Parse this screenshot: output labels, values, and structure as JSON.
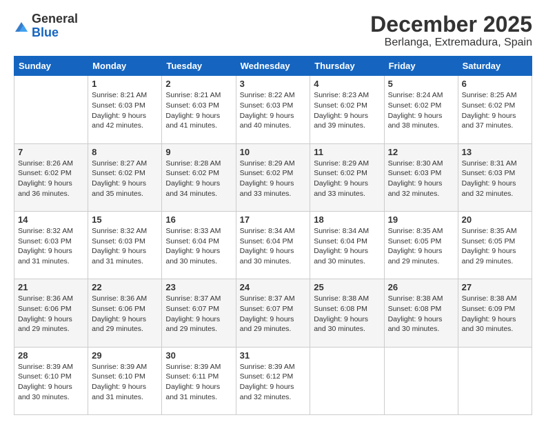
{
  "logo": {
    "general": "General",
    "blue": "Blue"
  },
  "header": {
    "title": "December 2025",
    "subtitle": "Berlanga, Extremadura, Spain"
  },
  "weekdays": [
    "Sunday",
    "Monday",
    "Tuesday",
    "Wednesday",
    "Thursday",
    "Friday",
    "Saturday"
  ],
  "weeks": [
    [
      {
        "day": "",
        "sunrise": "",
        "sunset": "",
        "daylight": ""
      },
      {
        "day": "1",
        "sunrise": "Sunrise: 8:21 AM",
        "sunset": "Sunset: 6:03 PM",
        "daylight": "Daylight: 9 hours and 42 minutes."
      },
      {
        "day": "2",
        "sunrise": "Sunrise: 8:21 AM",
        "sunset": "Sunset: 6:03 PM",
        "daylight": "Daylight: 9 hours and 41 minutes."
      },
      {
        "day": "3",
        "sunrise": "Sunrise: 8:22 AM",
        "sunset": "Sunset: 6:03 PM",
        "daylight": "Daylight: 9 hours and 40 minutes."
      },
      {
        "day": "4",
        "sunrise": "Sunrise: 8:23 AM",
        "sunset": "Sunset: 6:02 PM",
        "daylight": "Daylight: 9 hours and 39 minutes."
      },
      {
        "day": "5",
        "sunrise": "Sunrise: 8:24 AM",
        "sunset": "Sunset: 6:02 PM",
        "daylight": "Daylight: 9 hours and 38 minutes."
      },
      {
        "day": "6",
        "sunrise": "Sunrise: 8:25 AM",
        "sunset": "Sunset: 6:02 PM",
        "daylight": "Daylight: 9 hours and 37 minutes."
      }
    ],
    [
      {
        "day": "7",
        "sunrise": "Sunrise: 8:26 AM",
        "sunset": "Sunset: 6:02 PM",
        "daylight": "Daylight: 9 hours and 36 minutes."
      },
      {
        "day": "8",
        "sunrise": "Sunrise: 8:27 AM",
        "sunset": "Sunset: 6:02 PM",
        "daylight": "Daylight: 9 hours and 35 minutes."
      },
      {
        "day": "9",
        "sunrise": "Sunrise: 8:28 AM",
        "sunset": "Sunset: 6:02 PM",
        "daylight": "Daylight: 9 hours and 34 minutes."
      },
      {
        "day": "10",
        "sunrise": "Sunrise: 8:29 AM",
        "sunset": "Sunset: 6:02 PM",
        "daylight": "Daylight: 9 hours and 33 minutes."
      },
      {
        "day": "11",
        "sunrise": "Sunrise: 8:29 AM",
        "sunset": "Sunset: 6:02 PM",
        "daylight": "Daylight: 9 hours and 33 minutes."
      },
      {
        "day": "12",
        "sunrise": "Sunrise: 8:30 AM",
        "sunset": "Sunset: 6:03 PM",
        "daylight": "Daylight: 9 hours and 32 minutes."
      },
      {
        "day": "13",
        "sunrise": "Sunrise: 8:31 AM",
        "sunset": "Sunset: 6:03 PM",
        "daylight": "Daylight: 9 hours and 32 minutes."
      }
    ],
    [
      {
        "day": "14",
        "sunrise": "Sunrise: 8:32 AM",
        "sunset": "Sunset: 6:03 PM",
        "daylight": "Daylight: 9 hours and 31 minutes."
      },
      {
        "day": "15",
        "sunrise": "Sunrise: 8:32 AM",
        "sunset": "Sunset: 6:03 PM",
        "daylight": "Daylight: 9 hours and 31 minutes."
      },
      {
        "day": "16",
        "sunrise": "Sunrise: 8:33 AM",
        "sunset": "Sunset: 6:04 PM",
        "daylight": "Daylight: 9 hours and 30 minutes."
      },
      {
        "day": "17",
        "sunrise": "Sunrise: 8:34 AM",
        "sunset": "Sunset: 6:04 PM",
        "daylight": "Daylight: 9 hours and 30 minutes."
      },
      {
        "day": "18",
        "sunrise": "Sunrise: 8:34 AM",
        "sunset": "Sunset: 6:04 PM",
        "daylight": "Daylight: 9 hours and 30 minutes."
      },
      {
        "day": "19",
        "sunrise": "Sunrise: 8:35 AM",
        "sunset": "Sunset: 6:05 PM",
        "daylight": "Daylight: 9 hours and 29 minutes."
      },
      {
        "day": "20",
        "sunrise": "Sunrise: 8:35 AM",
        "sunset": "Sunset: 6:05 PM",
        "daylight": "Daylight: 9 hours and 29 minutes."
      }
    ],
    [
      {
        "day": "21",
        "sunrise": "Sunrise: 8:36 AM",
        "sunset": "Sunset: 6:06 PM",
        "daylight": "Daylight: 9 hours and 29 minutes."
      },
      {
        "day": "22",
        "sunrise": "Sunrise: 8:36 AM",
        "sunset": "Sunset: 6:06 PM",
        "daylight": "Daylight: 9 hours and 29 minutes."
      },
      {
        "day": "23",
        "sunrise": "Sunrise: 8:37 AM",
        "sunset": "Sunset: 6:07 PM",
        "daylight": "Daylight: 9 hours and 29 minutes."
      },
      {
        "day": "24",
        "sunrise": "Sunrise: 8:37 AM",
        "sunset": "Sunset: 6:07 PM",
        "daylight": "Daylight: 9 hours and 29 minutes."
      },
      {
        "day": "25",
        "sunrise": "Sunrise: 8:38 AM",
        "sunset": "Sunset: 6:08 PM",
        "daylight": "Daylight: 9 hours and 30 minutes."
      },
      {
        "day": "26",
        "sunrise": "Sunrise: 8:38 AM",
        "sunset": "Sunset: 6:08 PM",
        "daylight": "Daylight: 9 hours and 30 minutes."
      },
      {
        "day": "27",
        "sunrise": "Sunrise: 8:38 AM",
        "sunset": "Sunset: 6:09 PM",
        "daylight": "Daylight: 9 hours and 30 minutes."
      }
    ],
    [
      {
        "day": "28",
        "sunrise": "Sunrise: 8:39 AM",
        "sunset": "Sunset: 6:10 PM",
        "daylight": "Daylight: 9 hours and 30 minutes."
      },
      {
        "day": "29",
        "sunrise": "Sunrise: 8:39 AM",
        "sunset": "Sunset: 6:10 PM",
        "daylight": "Daylight: 9 hours and 31 minutes."
      },
      {
        "day": "30",
        "sunrise": "Sunrise: 8:39 AM",
        "sunset": "Sunset: 6:11 PM",
        "daylight": "Daylight: 9 hours and 31 minutes."
      },
      {
        "day": "31",
        "sunrise": "Sunrise: 8:39 AM",
        "sunset": "Sunset: 6:12 PM",
        "daylight": "Daylight: 9 hours and 32 minutes."
      },
      {
        "day": "",
        "sunrise": "",
        "sunset": "",
        "daylight": ""
      },
      {
        "day": "",
        "sunrise": "",
        "sunset": "",
        "daylight": ""
      },
      {
        "day": "",
        "sunrise": "",
        "sunset": "",
        "daylight": ""
      }
    ]
  ]
}
